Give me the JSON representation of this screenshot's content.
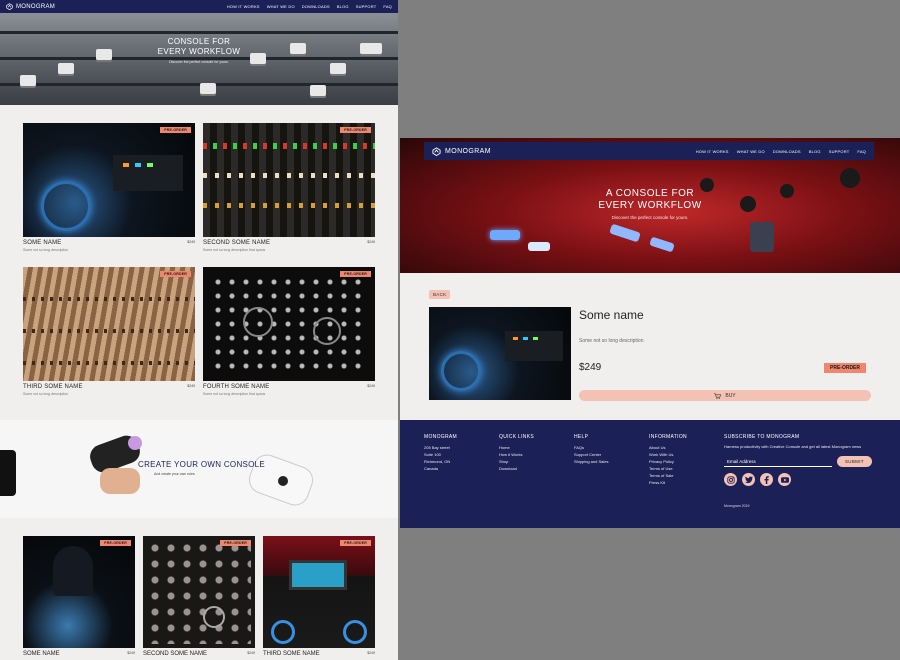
{
  "brand": "MONOGRAM",
  "nav_links": [
    "HOW IT WORKS",
    "WHAT WE DO",
    "DOWNLOADS",
    "BLOG",
    "SUPPORT",
    "FAQ"
  ],
  "left_page": {
    "hero": {
      "title_line1": "CONSOLE FOR",
      "title_line2": "EVERY WORKFLOW",
      "subtitle": "Discover the perfect console for yours."
    },
    "products": [
      {
        "name": "SOME NAME",
        "price": "$249",
        "badge": "PRE-ORDER",
        "desc": "Some not so long description"
      },
      {
        "name": "SECOND SOME NAME",
        "price": "$249",
        "badge": "PRE-ORDER",
        "desc": "Some not so long description that spans"
      },
      {
        "name": "THIRD SOME NAME",
        "price": "$249",
        "badge": "PRE-ORDER",
        "desc": "Some not so long description"
      },
      {
        "name": "FOURTH SOME NAME",
        "price": "$249",
        "badge": "PRE-ORDER",
        "desc": "Some not so long description that spans"
      }
    ],
    "create": {
      "title": "CREATE YOUR OWN CONSOLE",
      "subtitle": "And create your own rules"
    },
    "more_products": [
      {
        "name": "SOME NAME",
        "price": "$249",
        "badge": "PRE-ORDER"
      },
      {
        "name": "SECOND SOME NAME",
        "price": "$249",
        "badge": "PRE-ORDER"
      },
      {
        "name": "THIRD SOME NAME",
        "price": "$249",
        "badge": "PRE-ORDER"
      }
    ]
  },
  "right_page": {
    "hero": {
      "title_line1": "A CONSOLE FOR",
      "title_line2": "EVERY WORKFLOW",
      "subtitle": "Discover the perfect console for yours."
    },
    "back_label": "BACK",
    "product": {
      "name": "Some name",
      "desc": "Some not so long description",
      "price": "$249",
      "badge": "PRE-ORDER",
      "buy_label": "BUY"
    },
    "footer": {
      "columns": [
        {
          "title": "MONOGRAM",
          "items": [
            "205 Bay street",
            "Suite 100",
            "Richmond, ON",
            "Canada"
          ]
        },
        {
          "title": "QUICK LINKS",
          "items": [
            "Home",
            "How it Works",
            "Shop",
            "Download"
          ]
        },
        {
          "title": "HELP",
          "items": [
            "FAQs",
            "Support Center",
            "Shipping and Sales"
          ]
        },
        {
          "title": "INFORMATION",
          "items": [
            "About Us",
            "Work With Us",
            "Privacy Policy",
            "Terms of Use",
            "Terms of Sale",
            "Press Kit"
          ]
        }
      ],
      "subscribe_title": "SUBSCRIBE TO MONOGRAM",
      "subscribe_text": "Harness productivity with Creative Console and get all latest Monogram news",
      "email_placeholder": "Email Address",
      "submit_label": "SUBMIT",
      "socials": [
        "instagram-icon",
        "twitter-icon",
        "facebook-icon",
        "youtube-icon"
      ],
      "copyright": "Monogram 2019"
    }
  },
  "colors": {
    "navy": "#1b2157",
    "badge": "#f0866e",
    "peach": "#f3c2b4",
    "bg": "#f1efed"
  }
}
